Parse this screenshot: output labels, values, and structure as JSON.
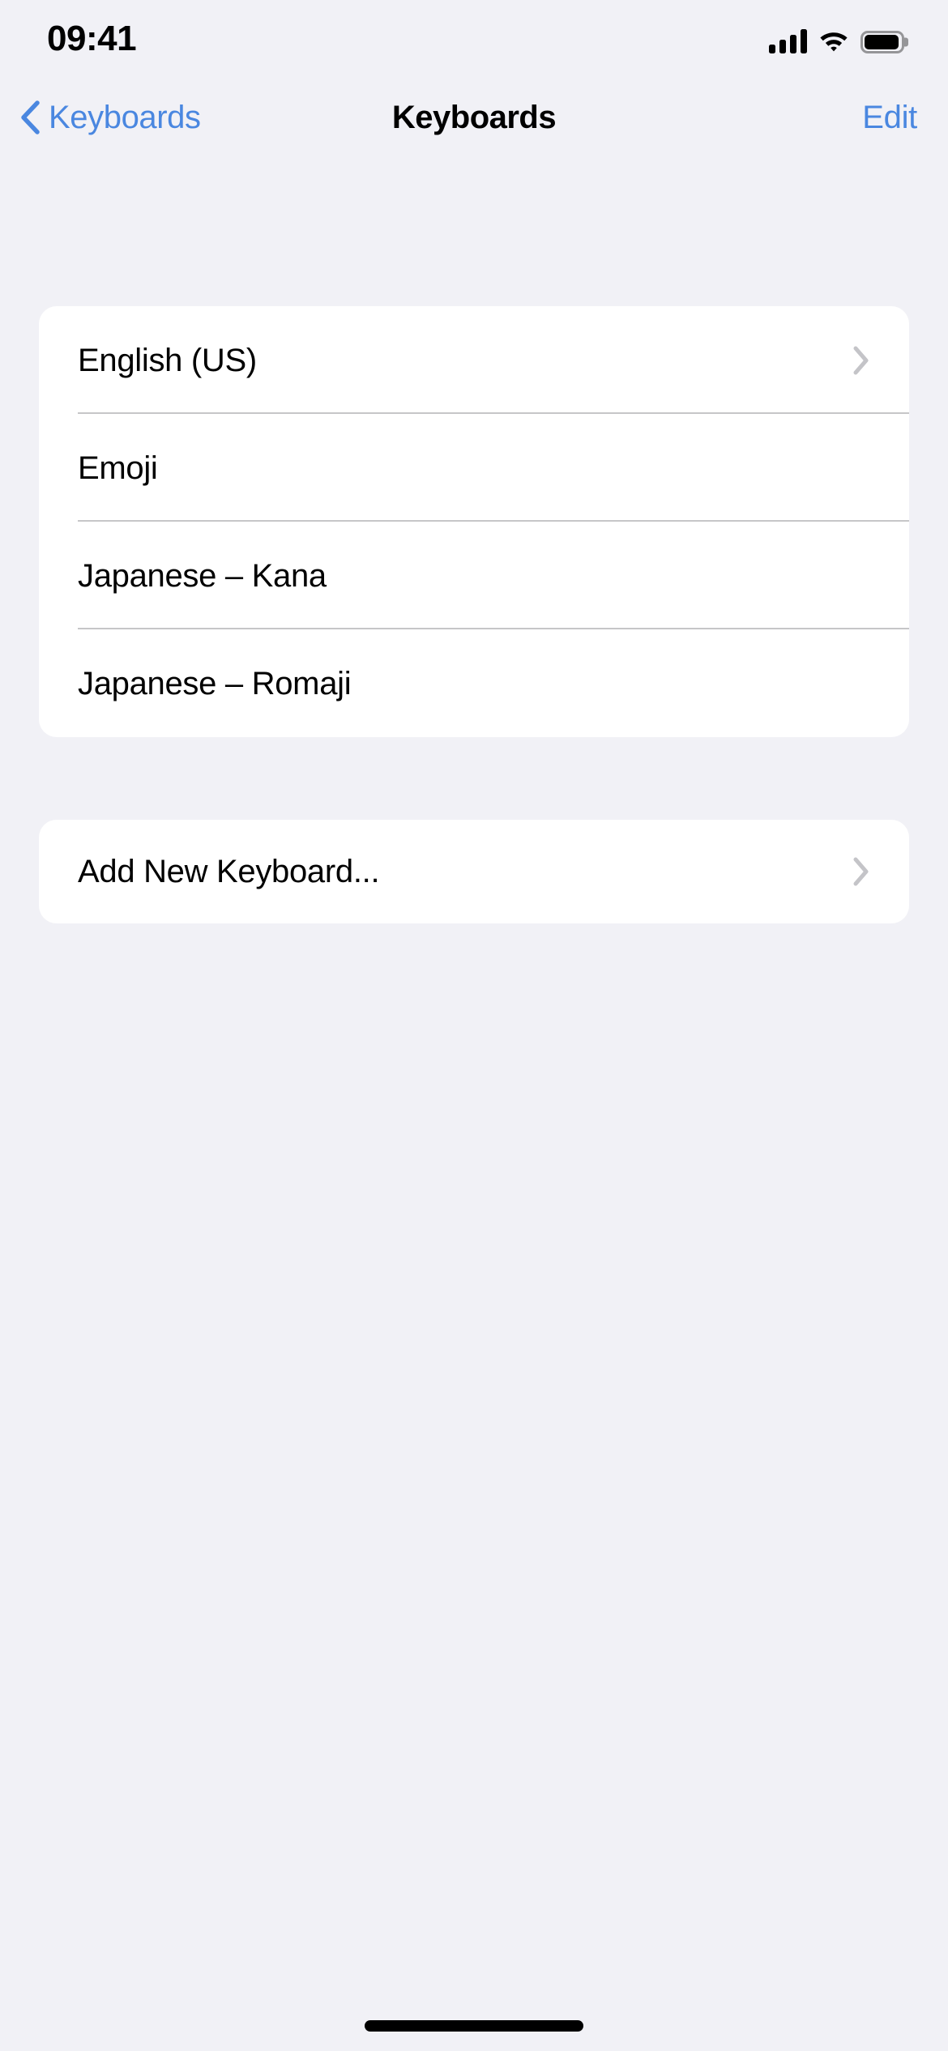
{
  "status_bar": {
    "time": "09:41",
    "cellular_icon": "cellular-signal-icon",
    "cellular_bars_filled": 4,
    "cellular_bars_total": 4,
    "wifi_icon": "wifi-icon",
    "battery_icon": "battery-icon",
    "battery_level_percent": 100
  },
  "nav_bar": {
    "back_label": "Keyboards",
    "back_icon": "chevron-left-icon",
    "title": "Keyboards",
    "edit_label": "Edit",
    "accent_color": "#4A87E0"
  },
  "sections": [
    {
      "id": "active-keyboards",
      "rows": [
        {
          "label": "English (US)",
          "has_disclosure": true
        },
        {
          "label": "Emoji",
          "has_disclosure": false
        },
        {
          "label": "Japanese – Kana",
          "has_disclosure": false
        },
        {
          "label": "Japanese – Romaji",
          "has_disclosure": false
        }
      ]
    },
    {
      "id": "add-keyboard",
      "rows": [
        {
          "label": "Add New Keyboard...",
          "has_disclosure": true
        }
      ]
    }
  ],
  "colors": {
    "page_background": "#F1F1F6",
    "card_background": "#FFFFFF",
    "separator": "#C6C6C8",
    "disclosure_chevron": "#C4C4C8",
    "primary_text": "#000000",
    "tint": "#4A87E0"
  },
  "home_indicator": {
    "label": "home-indicator"
  }
}
